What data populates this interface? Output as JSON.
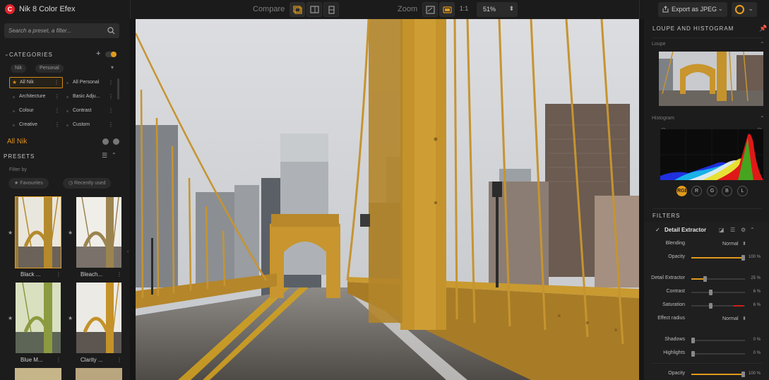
{
  "app": {
    "title": "Nik 8 Color Efex",
    "logo_letter": "C"
  },
  "toolbar": {
    "compare_label": "Compare",
    "zoom_label": "Zoom",
    "zoom_one_to_one": "1:1",
    "zoom_value": "51%",
    "export_label": "Export as JPEG"
  },
  "search": {
    "placeholder": "Search a preset, a filter..."
  },
  "categories": {
    "header": "CATEGORIES",
    "tags": [
      "Nik",
      "Personal"
    ],
    "items": [
      {
        "label": "All Nik",
        "active": true
      },
      {
        "label": "All Personal"
      },
      {
        "label": "Architecture"
      },
      {
        "label": "Basic Adju..."
      },
      {
        "label": "Colour"
      },
      {
        "label": "Contrast"
      },
      {
        "label": "Creative"
      },
      {
        "label": "Custom"
      }
    ]
  },
  "collection": {
    "title": "All Nik"
  },
  "presets": {
    "header": "PRESETS",
    "filter_by": "Filter by",
    "filters": [
      "Favourites",
      "Recently used"
    ],
    "thumbs": [
      {
        "label": "Black ..."
      },
      {
        "label": "Bleach..."
      },
      {
        "label": "Blue M..."
      },
      {
        "label": "Clarity ..."
      }
    ]
  },
  "right_panel": {
    "loupe_header": "LOUPE AND HISTOGRAM",
    "loupe_label": "Loupe",
    "histogram_label": "Histogram",
    "channels": [
      "RGB",
      "R",
      "G",
      "B",
      "L"
    ],
    "filters_header": "FILTERS"
  },
  "filter": {
    "name": "Detail Extractor",
    "params": [
      {
        "label": "Blending",
        "kind": "select",
        "value": "Normal"
      },
      {
        "label": "Opacity",
        "kind": "slider",
        "value": "100 %",
        "level": 1.0
      },
      {
        "label": "Detail Extractor",
        "kind": "slider",
        "value": "25 %",
        "level": 0.25
      },
      {
        "label": "Contrast",
        "kind": "slider",
        "value": "6 %",
        "level": 0.36
      },
      {
        "label": "Saturation",
        "kind": "slider",
        "value": "6 %",
        "level": 0.36
      },
      {
        "label": "Effect radius",
        "kind": "select",
        "value": "Normal"
      },
      {
        "label": "Shadows",
        "kind": "slider",
        "value": "0 %",
        "level": 0.0
      },
      {
        "label": "Highlights",
        "kind": "slider",
        "value": "0 %",
        "level": 0.0
      },
      {
        "label": "Opacity",
        "kind": "slider",
        "value": "100 %",
        "level": 1.0
      }
    ]
  },
  "colors": {
    "accent": "#e09a1c",
    "bridge": "#c7962c",
    "logo": "#e0242b"
  }
}
